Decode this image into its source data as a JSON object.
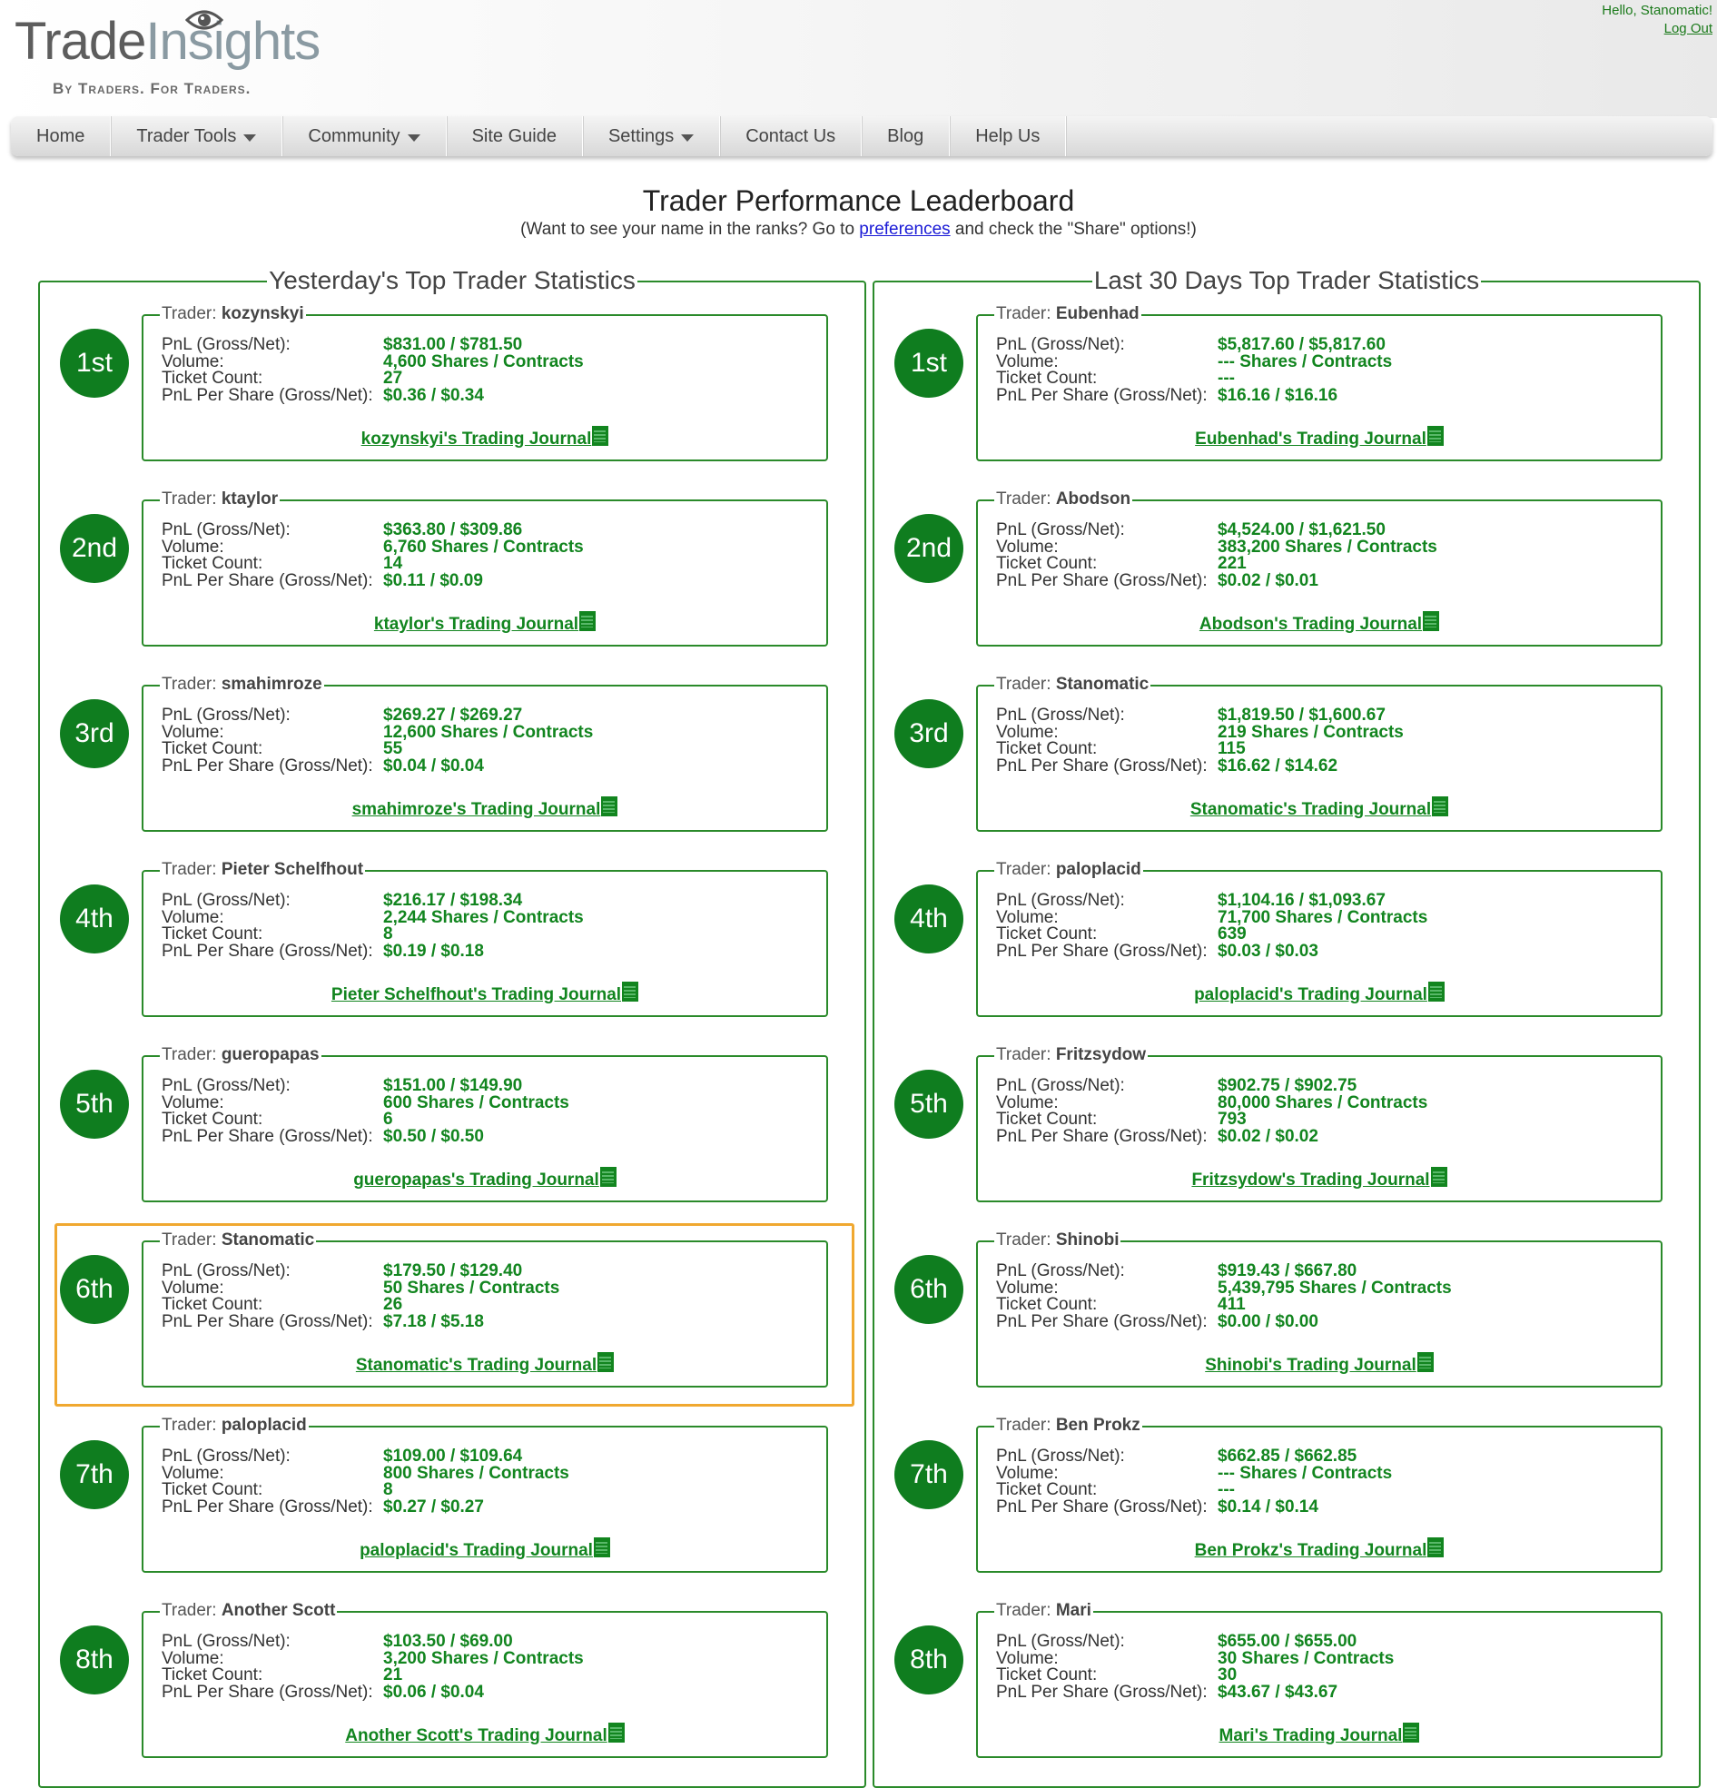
{
  "header": {
    "logo": {
      "trade": "Trade",
      "insights": "Insights",
      "tagline": "By Traders. For Traders."
    },
    "greeting": "Hello, Stanomatic!",
    "logout": "Log Out"
  },
  "nav": [
    {
      "label": "Home",
      "dropdown": false
    },
    {
      "label": "Trader Tools",
      "dropdown": true
    },
    {
      "label": "Community",
      "dropdown": true
    },
    {
      "label": "Site Guide",
      "dropdown": false
    },
    {
      "label": "Settings",
      "dropdown": true
    },
    {
      "label": "Contact Us",
      "dropdown": false
    },
    {
      "label": "Blog",
      "dropdown": false
    },
    {
      "label": "Help Us",
      "dropdown": false
    }
  ],
  "page": {
    "title": "Trader Performance Leaderboard",
    "subtitle_before": "(Want to see your name in the ranks? Go to ",
    "subtitle_link": "preferences",
    "subtitle_after": " and check the \"Share\" options!)"
  },
  "labels": {
    "trader": "Trader: ",
    "pnl": "PnL (Gross/Net):",
    "volume": "Volume:",
    "tickets": "Ticket Count:",
    "pps": "PnL Per Share (Gross/Net):"
  },
  "panels": [
    {
      "title": "Yesterday's Top Trader Statistics",
      "entries": [
        {
          "rank": "1st",
          "trader": "kozynskyi",
          "pnl": "$831.00 / $781.50",
          "volume": "4,600 Shares / Contracts",
          "tickets": "27",
          "pps": "$0.36 / $0.34",
          "journal": "kozynskyi's Trading Journal"
        },
        {
          "rank": "2nd",
          "trader": "ktaylor",
          "pnl": "$363.80 / $309.86",
          "volume": "6,760 Shares / Contracts",
          "tickets": "14",
          "pps": "$0.11 / $0.09",
          "journal": "ktaylor's Trading Journal"
        },
        {
          "rank": "3rd",
          "trader": "smahimroze",
          "pnl": "$269.27 / $269.27",
          "volume": "12,600 Shares / Contracts",
          "tickets": "55",
          "pps": "$0.04 / $0.04",
          "journal": "smahimroze's Trading Journal"
        },
        {
          "rank": "4th",
          "trader": "Pieter Schelfhout",
          "pnl": "$216.17 / $198.34",
          "volume": "2,244 Shares / Contracts",
          "tickets": "8",
          "pps": "$0.19 / $0.18",
          "journal": "Pieter Schelfhout's Trading Journal"
        },
        {
          "rank": "5th",
          "trader": "gueropapas",
          "pnl": "$151.00 / $149.90",
          "volume": "600 Shares / Contracts",
          "tickets": "6",
          "pps": "$0.50 / $0.50",
          "journal": "gueropapas's Trading Journal"
        },
        {
          "rank": "6th",
          "trader": "Stanomatic",
          "pnl": "$179.50 / $129.40",
          "volume": "50 Shares / Contracts",
          "tickets": "26",
          "pps": "$7.18 / $5.18",
          "journal": "Stanomatic's Trading Journal"
        },
        {
          "rank": "7th",
          "trader": "paloplacid",
          "pnl": "$109.00 / $109.64",
          "volume": "800 Shares / Contracts",
          "tickets": "8",
          "pps": "$0.27 / $0.27",
          "journal": "paloplacid's Trading Journal"
        },
        {
          "rank": "8th",
          "trader": "Another Scott",
          "pnl": "$103.50 / $69.00",
          "volume": "3,200 Shares / Contracts",
          "tickets": "21",
          "pps": "$0.06 / $0.04",
          "journal": "Another Scott's Trading Journal"
        }
      ]
    },
    {
      "title": "Last 30 Days Top Trader Statistics",
      "entries": [
        {
          "rank": "1st",
          "trader": "Eubenhad",
          "pnl": "$5,817.60 / $5,817.60",
          "volume": "--- Shares / Contracts",
          "tickets": "---",
          "pps": "$16.16 / $16.16",
          "journal": "Eubenhad's Trading Journal"
        },
        {
          "rank": "2nd",
          "trader": "Abodson",
          "pnl": "$4,524.00 / $1,621.50",
          "volume": "383,200 Shares / Contracts",
          "tickets": "221",
          "pps": "$0.02 / $0.01",
          "journal": "Abodson's Trading Journal"
        },
        {
          "rank": "3rd",
          "trader": "Stanomatic",
          "pnl": "$1,819.50 / $1,600.67",
          "volume": "219 Shares / Contracts",
          "tickets": "115",
          "pps": "$16.62 / $14.62",
          "journal": "Stanomatic's Trading Journal"
        },
        {
          "rank": "4th",
          "trader": "paloplacid",
          "pnl": "$1,104.16 / $1,093.67",
          "volume": "71,700 Shares / Contracts",
          "tickets": "639",
          "pps": "$0.03 / $0.03",
          "journal": "paloplacid's Trading Journal"
        },
        {
          "rank": "5th",
          "trader": "Fritzsydow",
          "pnl": "$902.75 / $902.75",
          "volume": "80,000 Shares / Contracts",
          "tickets": "793",
          "pps": "$0.02 / $0.02",
          "journal": "Fritzsydow's Trading Journal"
        },
        {
          "rank": "6th",
          "trader": "Shinobi",
          "pnl": "$919.43 / $667.80",
          "volume": "5,439,795 Shares / Contracts",
          "tickets": "411",
          "pps": "$0.00 / $0.00",
          "journal": "Shinobi's Trading Journal"
        },
        {
          "rank": "7th",
          "trader": "Ben Prokz",
          "pnl": "$662.85 / $662.85",
          "volume": "--- Shares / Contracts",
          "tickets": "---",
          "pps": "$0.14 / $0.14",
          "journal": "Ben Prokz's Trading Journal"
        },
        {
          "rank": "8th",
          "trader": "Mari",
          "pnl": "$655.00 / $655.00",
          "volume": "30 Shares / Contracts",
          "tickets": "30",
          "pps": "$43.67 / $43.67",
          "journal": "Mari's Trading Journal"
        }
      ]
    }
  ],
  "colors": {
    "green": "#12851f",
    "rank_circle": "#0f7d1f",
    "highlight": "#f0a830"
  }
}
